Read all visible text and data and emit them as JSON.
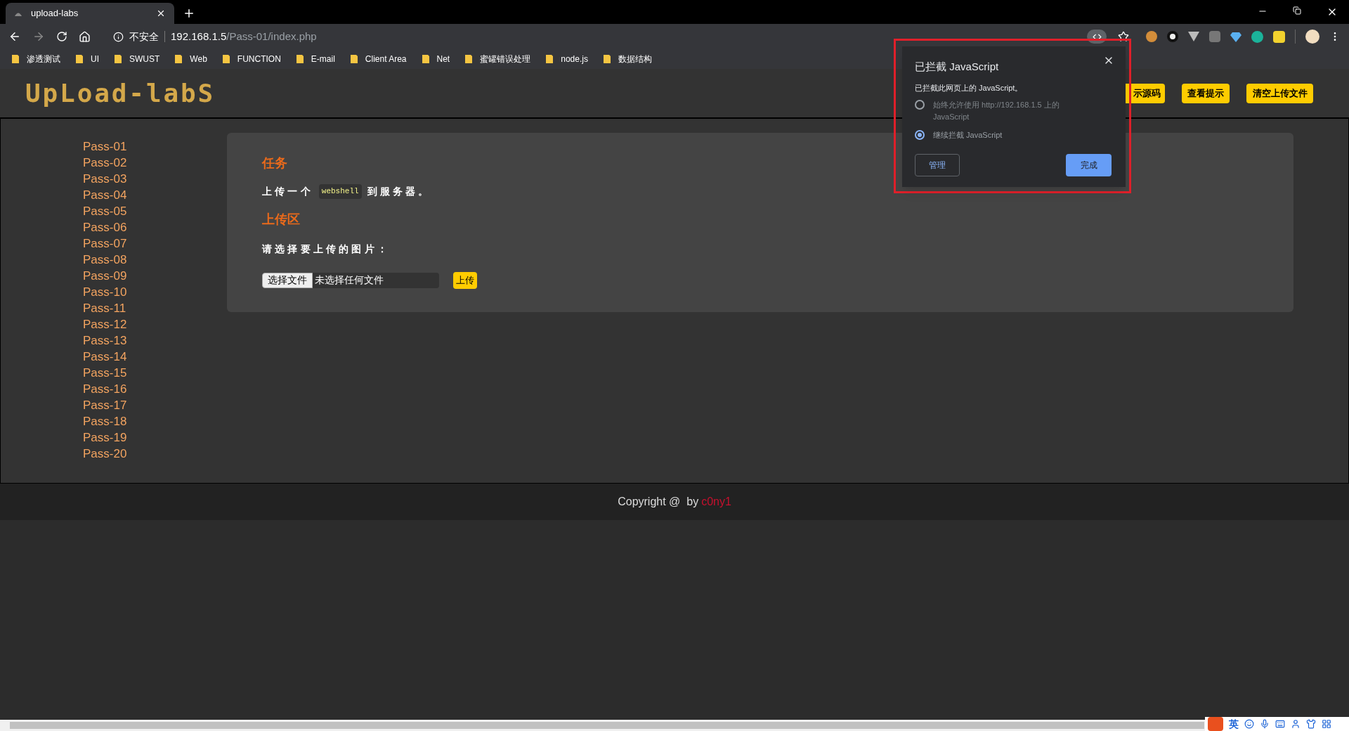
{
  "browser": {
    "tab": {
      "title": "upload-labs"
    },
    "address": {
      "security": "不安全",
      "host": "192.168.1.5",
      "path": "/Pass-01/index.php"
    },
    "bookmarks": [
      "渗透测试",
      "UI",
      "SWUST",
      "Web",
      "FUNCTION",
      "E-mail",
      "Client Area",
      "Net",
      "蜜罐错误处理",
      "node.js",
      "数据结构"
    ]
  },
  "header": {
    "logo": "UpLoad-labS",
    "buttons": [
      "示源码",
      "查看提示",
      "清空上传文件"
    ]
  },
  "sidebar": {
    "items": [
      {
        "label": "Pass-01"
      },
      {
        "label": "Pass-02"
      },
      {
        "label": "Pass-03"
      },
      {
        "label": "Pass-04"
      },
      {
        "label": "Pass-05"
      },
      {
        "label": "Pass-06"
      },
      {
        "label": "Pass-07"
      },
      {
        "label": "Pass-08"
      },
      {
        "label": "Pass-09"
      },
      {
        "label": "Pass-10"
      },
      {
        "label": "Pass-11"
      },
      {
        "label": "Pass-12"
      },
      {
        "label": "Pass-13"
      },
      {
        "label": "Pass-14"
      },
      {
        "label": "Pass-15"
      },
      {
        "label": "Pass-16"
      },
      {
        "label": "Pass-17"
      },
      {
        "label": "Pass-18"
      },
      {
        "label": "Pass-19"
      },
      {
        "label": "Pass-20"
      }
    ]
  },
  "task": {
    "heading": "任务",
    "before": "上传一个",
    "code": "webshell",
    "after": "到服务器。"
  },
  "upload": {
    "heading": "上传区",
    "prompt": "请选择要上传的图片：",
    "choose_button": "选择文件",
    "file_status": "未选择任何文件",
    "submit": "上传"
  },
  "footer": {
    "text": "Copyright @  by",
    "author": "c0ny1"
  },
  "popup": {
    "title": "已拦截 JavaScript",
    "message": "已拦截此网页上的 JavaScript。",
    "options": [
      {
        "label": "始终允许使用 http://192.168.1.5 上的 JavaScript",
        "selected": false
      },
      {
        "label": "继续拦截 JavaScript",
        "selected": true
      }
    ],
    "manage": "管理",
    "done": "完成"
  },
  "ime_bar": {
    "mode": "英"
  }
}
